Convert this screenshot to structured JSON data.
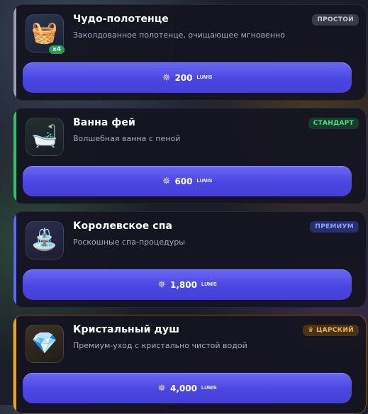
{
  "colors": {
    "button": "#4f4ae6",
    "accent_basic": "#9aa0b5",
    "accent_standard": "#2ec36a",
    "accent_premium": "#5b6cf5",
    "accent_royal": "#e0a62b"
  },
  "items": [
    {
      "title": "Чудо-полотенце",
      "description": "Заколдованное полотенце, очищающее мгновенно",
      "tier": "ПРОСТОЙ",
      "quantity": "x4",
      "price": "200",
      "currency": "LUMIS",
      "icon": "towel-icon"
    },
    {
      "title": "Ванна фей",
      "description": "Волшебная ванна с пеной",
      "tier": "СТАНДАРТ",
      "price": "600",
      "currency": "LUMIS",
      "icon": "bathtub-icon"
    },
    {
      "title": "Королевское спа",
      "description": "Роскошные спа-процедуры",
      "tier": "ПРЕМИУМ",
      "price": "1,800",
      "currency": "LUMIS",
      "icon": "spa-icon"
    },
    {
      "title": "Кристальный душ",
      "description": "Премиум-уход с кристально чистой водой",
      "tier": "ЦАРСКИЙ",
      "tier_icon": "crown-icon",
      "price": "4,000",
      "currency": "LUMIS",
      "icon": "crystal-shower-icon"
    }
  ]
}
